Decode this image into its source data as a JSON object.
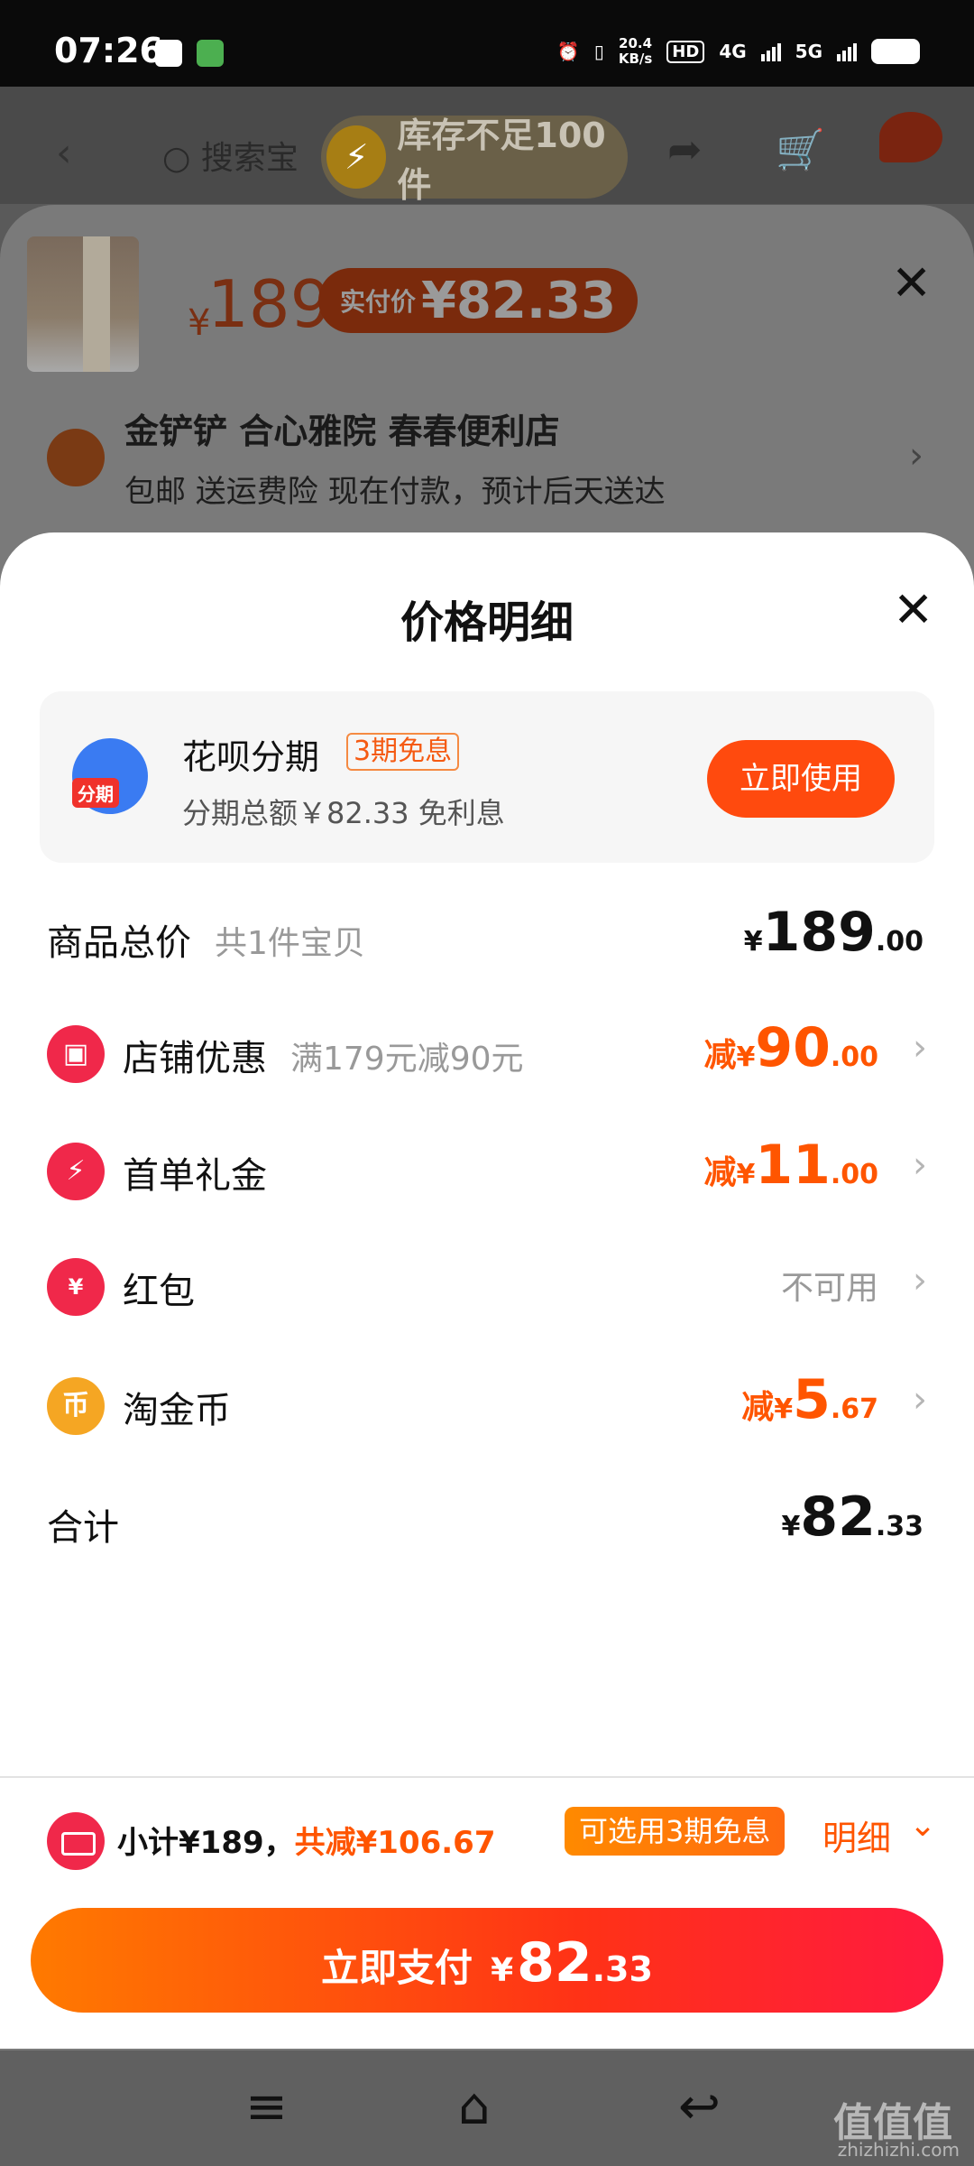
{
  "status_bar": {
    "time": "07:26",
    "net_speed": "20.4",
    "net_unit": "KB/s",
    "hd": "HD",
    "signal1": "4G",
    "signal2": "5G"
  },
  "background_page": {
    "search_text": "搜索宝",
    "stock_alert": "库存不足100件"
  },
  "sku_sheet": {
    "currency": "¥",
    "price": "189",
    "paid_label": "实付价",
    "paid_value": "¥82.33",
    "address": "金铲铲 合心雅院 春春便利店",
    "shipping": "包邮 送运费险 现在付款，预计后天送达"
  },
  "price_detail": {
    "title": "价格明细",
    "huabei": {
      "logo_tag": "分期",
      "name": "花呗分期",
      "badge": "3期免息",
      "sub": "分期总额￥82.33 免利息",
      "button": "立即使用"
    },
    "rows": [
      {
        "label": "商品总价",
        "sub": "共1件宝贝",
        "prefix": "",
        "yen": "¥",
        "int": "189",
        "dec": ".00"
      },
      {
        "label": "店铺优惠",
        "sub": "满179元减90元",
        "prefix": "减",
        "yen": "¥",
        "int": "90",
        "dec": ".00"
      },
      {
        "label": "首单礼金",
        "sub": "",
        "prefix": "减",
        "yen": "¥",
        "int": "11",
        "dec": ".00"
      },
      {
        "label": "红包",
        "sub": "",
        "status": "不可用"
      },
      {
        "label": "淘金币",
        "sub": "",
        "prefix": "减",
        "yen": "¥",
        "int": "5",
        "dec": ".67"
      },
      {
        "label": "合计",
        "sub": "",
        "prefix": "",
        "yen": "¥",
        "int": "82",
        "dec": ".33"
      }
    ],
    "icon_glyphs": {
      "redpacket": "¥",
      "coin": "币"
    }
  },
  "bottom_bar": {
    "subtotal": "小计¥189，",
    "discount": "共减¥106.67",
    "installment_badge": "可选用3期免息",
    "detail_link": "明细",
    "pay_label": "立即支付",
    "pay_yen": "¥",
    "pay_int": "82",
    "pay_dec": ".33"
  },
  "watermark": {
    "text": "值值值",
    "url": "zhizhizhi.com"
  },
  "colors": {
    "accent": "#ff5500",
    "button": "#ff4a0e"
  }
}
